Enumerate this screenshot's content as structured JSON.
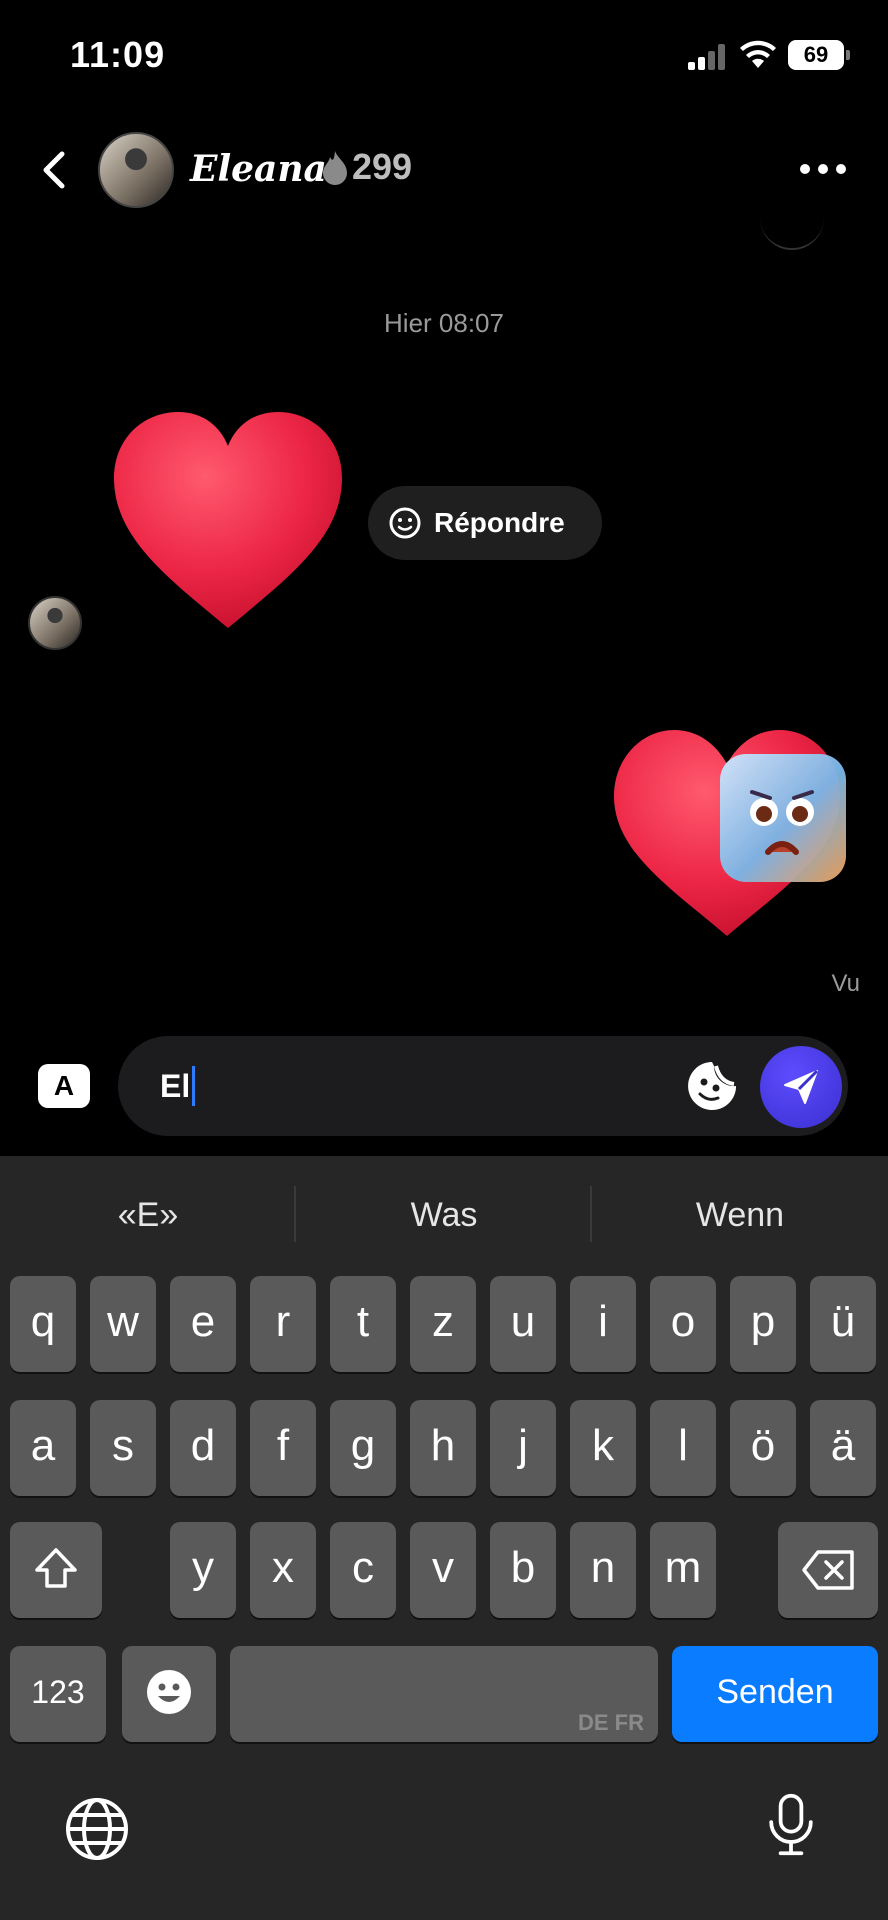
{
  "status_bar": {
    "time": "11:09",
    "battery": "69"
  },
  "header": {
    "contact_name": "Eleana",
    "streak_count": "299"
  },
  "chat": {
    "date_label": "Hier 08:07",
    "reply_label": "Répondre",
    "seen_label": "Vu"
  },
  "composer": {
    "a_button": "A",
    "text": "El"
  },
  "keyboard": {
    "suggestions": [
      "«E»",
      "Was",
      "Wenn"
    ],
    "row1": [
      "q",
      "w",
      "e",
      "r",
      "t",
      "z",
      "u",
      "i",
      "o",
      "p",
      "ü"
    ],
    "row2": [
      "a",
      "s",
      "d",
      "f",
      "g",
      "h",
      "j",
      "k",
      "l",
      "ö",
      "ä"
    ],
    "row3": [
      "y",
      "x",
      "c",
      "v",
      "b",
      "n",
      "m"
    ],
    "numbers_label": "123",
    "space_languages": "DE FR",
    "return_label": "Senden"
  },
  "colors": {
    "accent_blue": "#0a7cff",
    "send_purple": "#4b3cf0",
    "heart_red": "#e8203f"
  }
}
